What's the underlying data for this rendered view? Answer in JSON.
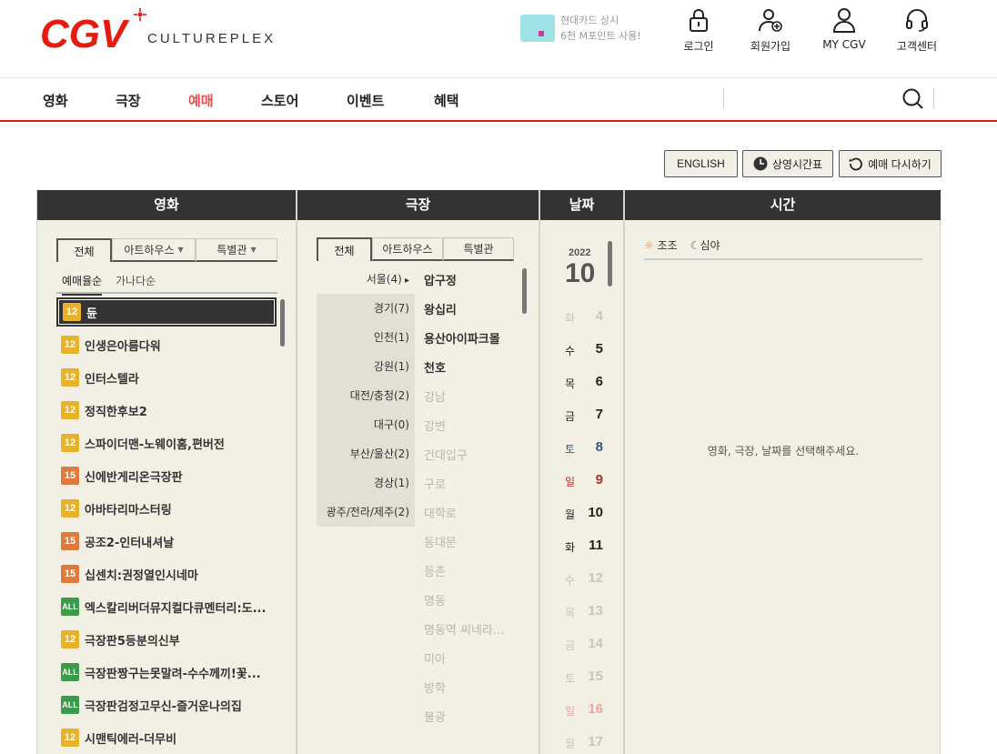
{
  "header": {
    "brand": "CGV",
    "culture": "CULTUREPLEX",
    "promo": "현대카드 상시\n6천 M포인트 사용!",
    "util": [
      {
        "label": "로그인",
        "icon": "lock-icon"
      },
      {
        "label": "회원가입",
        "icon": "user-add-icon"
      },
      {
        "label": "MY CGV",
        "icon": "user-icon"
      },
      {
        "label": "고객센터",
        "icon": "headset-icon"
      }
    ]
  },
  "nav": {
    "items": [
      "영화",
      "극장",
      "예매",
      "스토어",
      "이벤트",
      "혜택"
    ],
    "active": "예매"
  },
  "buttons": {
    "english": "ENGLISH",
    "schedule": "상영시간표",
    "reset": "예매 다시하기"
  },
  "columns": {
    "movie": "영화",
    "theater": "극장",
    "date": "날짜",
    "time": "시간"
  },
  "movie_tabs": [
    "전체",
    "아트하우스",
    "특별관"
  ],
  "sort": [
    "예매율순",
    "가나다순"
  ],
  "movies": [
    {
      "rating": "12",
      "title": "듄"
    },
    {
      "rating": "12",
      "title": "인생은아름다워"
    },
    {
      "rating": "12",
      "title": "인터스텔라"
    },
    {
      "rating": "12",
      "title": "정직한후보2"
    },
    {
      "rating": "12",
      "title": "스파이더맨-노웨이홈,편버전"
    },
    {
      "rating": "15",
      "title": "신에반게리온극장판"
    },
    {
      "rating": "12",
      "title": "아바타리마스터링"
    },
    {
      "rating": "15",
      "title": "공조2-인터내셔날"
    },
    {
      "rating": "15",
      "title": "십센치:권정열인시네마"
    },
    {
      "rating": "ALL",
      "title": "엑스칼리버더뮤지컬다큐멘터리:도..."
    },
    {
      "rating": "12",
      "title": "극장판5등분의신부"
    },
    {
      "rating": "ALL",
      "title": "극장판짱구는못말려-수수께끼!꽃..."
    },
    {
      "rating": "ALL",
      "title": "극장판검정고무신-즐거운나의집"
    },
    {
      "rating": "12",
      "title": "시맨틱에러-더무비"
    }
  ],
  "theater_tabs": [
    "전체",
    "아트하우스",
    "특별관"
  ],
  "regions": [
    "서울(4)",
    "경기(7)",
    "인천(1)",
    "강원(1)",
    "대전/충청(2)",
    "대구(0)",
    "부산/울산(2)",
    "경상(1)",
    "광주/전라/제주(2)"
  ],
  "theaters": [
    {
      "name": "압구정",
      "dim": false
    },
    {
      "name": "왕십리",
      "dim": false
    },
    {
      "name": "용산아이파크몰",
      "dim": false
    },
    {
      "name": "천호",
      "dim": false
    },
    {
      "name": "강남",
      "dim": true
    },
    {
      "name": "강변",
      "dim": true
    },
    {
      "name": "건대입구",
      "dim": true
    },
    {
      "name": "구로",
      "dim": true
    },
    {
      "name": "대학로",
      "dim": true
    },
    {
      "name": "동대문",
      "dim": true
    },
    {
      "name": "등촌",
      "dim": true
    },
    {
      "name": "명동",
      "dim": true
    },
    {
      "name": "명동역 씨네라...",
      "dim": true
    },
    {
      "name": "미아",
      "dim": true
    },
    {
      "name": "방학",
      "dim": true
    },
    {
      "name": "불광",
      "dim": true
    }
  ],
  "date": {
    "year": "2022",
    "month": "10",
    "days": [
      {
        "dow": "화",
        "day": "4",
        "style": "d-dim"
      },
      {
        "dow": "수",
        "day": "5",
        "style": "d-norm"
      },
      {
        "dow": "목",
        "day": "6",
        "style": "d-norm"
      },
      {
        "dow": "금",
        "day": "7",
        "style": "d-norm"
      },
      {
        "dow": "토",
        "day": "8",
        "style": "d-sat"
      },
      {
        "dow": "일",
        "day": "9",
        "style": "d-sun"
      },
      {
        "dow": "월",
        "day": "10",
        "style": "d-norm"
      },
      {
        "dow": "화",
        "day": "11",
        "style": "d-norm"
      },
      {
        "dow": "수",
        "day": "12",
        "style": "d-dim"
      },
      {
        "dow": "목",
        "day": "13",
        "style": "d-dim"
      },
      {
        "dow": "금",
        "day": "14",
        "style": "d-dim"
      },
      {
        "dow": "토",
        "day": "15",
        "style": "d-dim"
      },
      {
        "dow": "일",
        "day": "16",
        "style": "d-sun-dim"
      },
      {
        "dow": "월",
        "day": "17",
        "style": "d-dim"
      }
    ]
  },
  "time": {
    "morning": "조조",
    "night": "심야",
    "message": "영화, 극장, 날짜를 선택해주세요."
  }
}
